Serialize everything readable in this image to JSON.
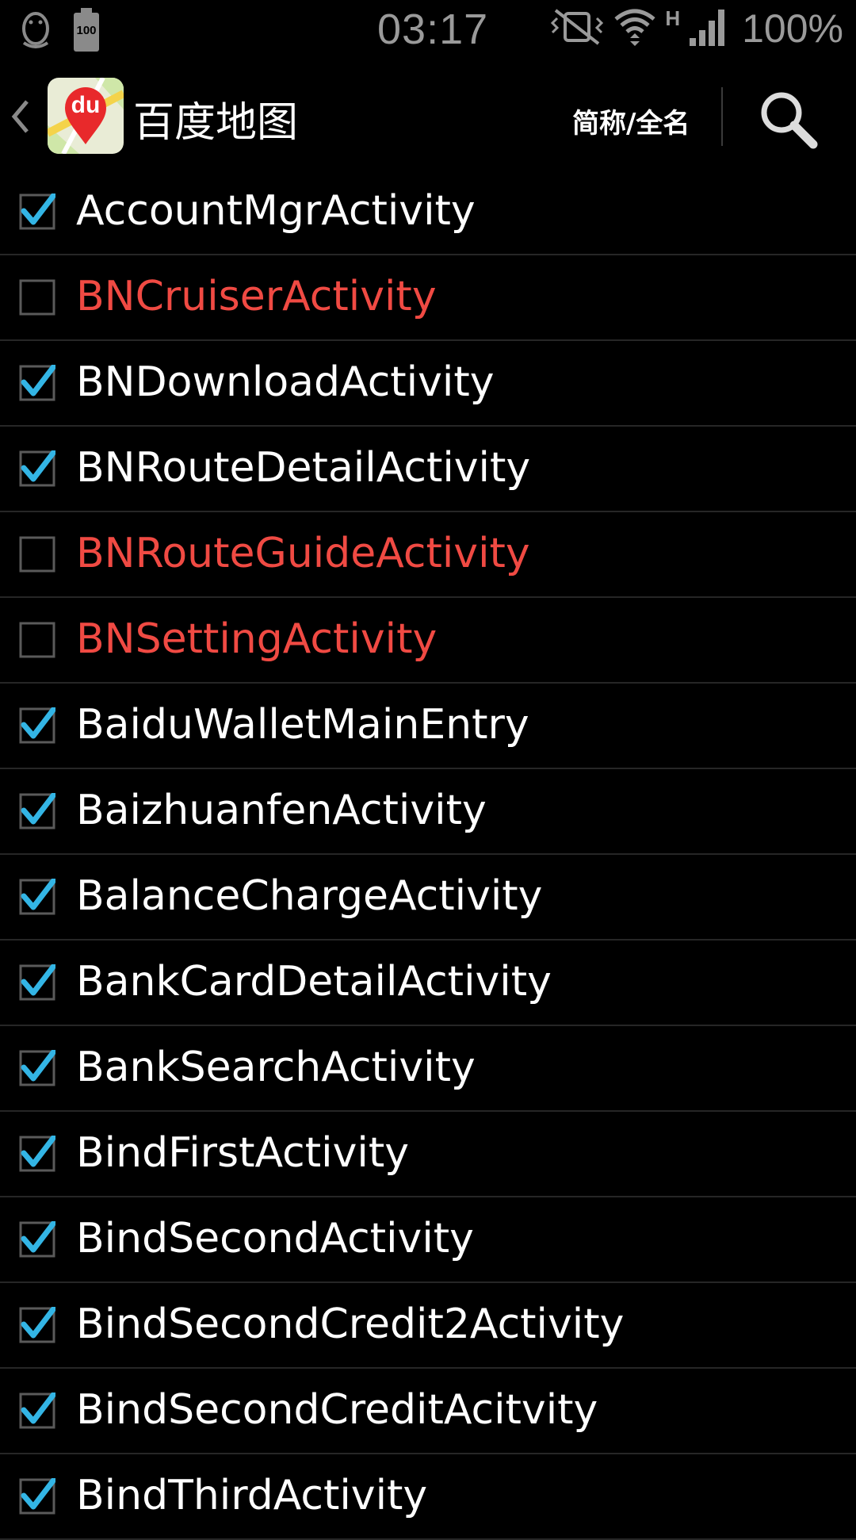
{
  "status_bar": {
    "time": "03:17",
    "battery_icon_text": "100",
    "battery_percent": "100%",
    "network_type": "H",
    "icons": [
      "penguin-icon",
      "battery-icon",
      "vibrate-mute-icon",
      "wifi-icon",
      "signal-icon"
    ]
  },
  "action_bar": {
    "app_icon_text": "du",
    "title": "百度地图",
    "toggle_label": "简称/全名",
    "icons": [
      "chevron-left-icon",
      "search-icon"
    ]
  },
  "colors": {
    "enabled_text": "#ffffff",
    "disabled_text": "#f04a43",
    "check_blue": "#33b5e5"
  },
  "activities": [
    {
      "name": "AccountMgrActivity",
      "checked": true
    },
    {
      "name": "BNCruiserActivity",
      "checked": false
    },
    {
      "name": "BNDownloadActivity",
      "checked": true
    },
    {
      "name": "BNRouteDetailActivity",
      "checked": true
    },
    {
      "name": "BNRouteGuideActivity",
      "checked": false
    },
    {
      "name": "BNSettingActivity",
      "checked": false
    },
    {
      "name": "BaiduWalletMainEntry",
      "checked": true
    },
    {
      "name": "BaizhuanfenActivity",
      "checked": true
    },
    {
      "name": "BalanceChargeActivity",
      "checked": true
    },
    {
      "name": "BankCardDetailActivity",
      "checked": true
    },
    {
      "name": "BankSearchActivity",
      "checked": true
    },
    {
      "name": "BindFirstActivity",
      "checked": true
    },
    {
      "name": "BindSecondActivity",
      "checked": true
    },
    {
      "name": "BindSecondCredit2Activity",
      "checked": true
    },
    {
      "name": "BindSecondCreditAcitvity",
      "checked": true
    },
    {
      "name": "BindThirdActivity",
      "checked": true
    }
  ]
}
